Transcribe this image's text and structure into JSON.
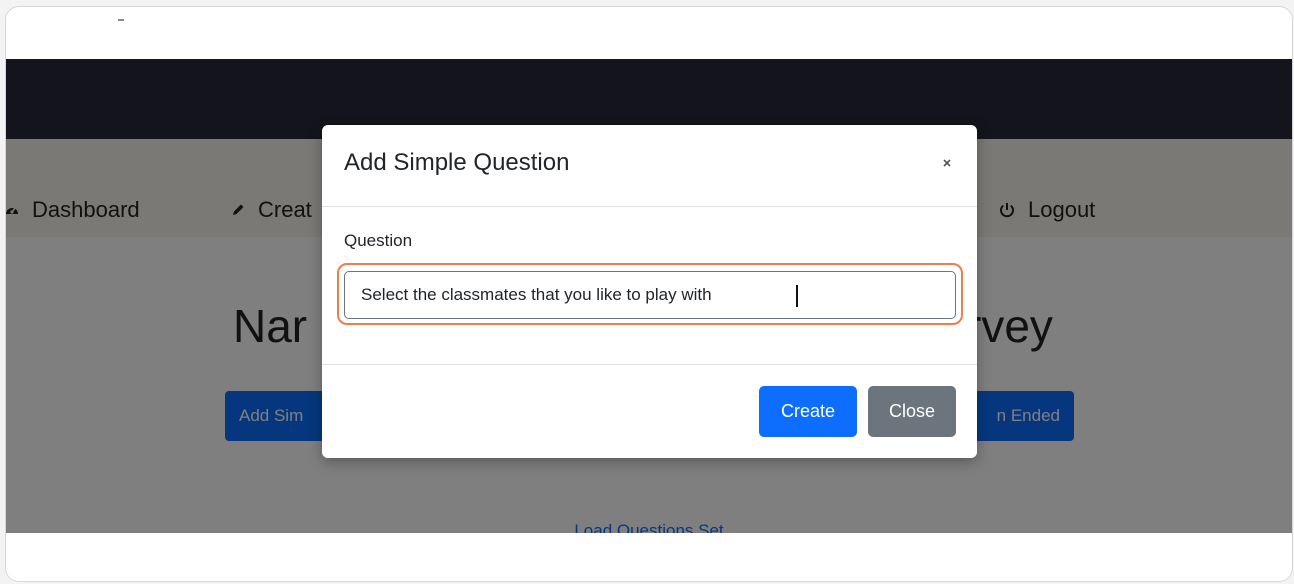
{
  "navbar": {
    "items": [
      {
        "label": "Dashboard",
        "icon": "dashboard-icon"
      },
      {
        "label": "Creat",
        "icon": "pencil-icon"
      },
      {
        "label": "Logout",
        "icon": "power-icon"
      }
    ]
  },
  "page": {
    "heading_left": "Nar",
    "heading_right": "rvey",
    "button_left_label": "Add Sim",
    "button_right_label": "n Ended",
    "load_link_label": "Load Questions Set"
  },
  "modal": {
    "title": "Add Simple Question",
    "close_symbol": "×",
    "question_label": "Question",
    "question_value": "Select the classmates that you like to play with",
    "create_label": "Create",
    "close_label": "Close"
  },
  "colors": {
    "primary": "#0d6efd",
    "secondary": "#6c757d",
    "focus_ring": "#f27c4a",
    "navbar_dark": "#292b38",
    "navbar_light": "#f6f3ea"
  }
}
